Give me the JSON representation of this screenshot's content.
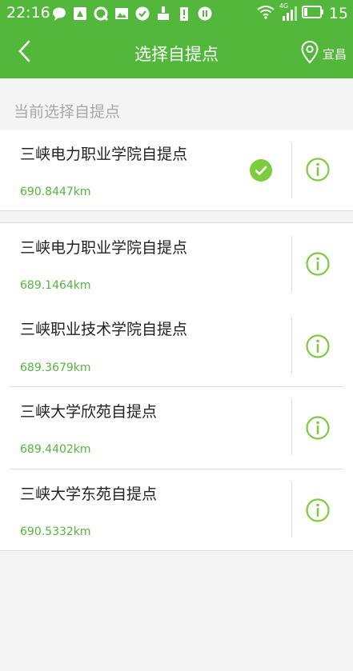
{
  "status_bar": {
    "time": "22:16",
    "battery_percent": "15",
    "network": "4G"
  },
  "header": {
    "title": "选择自提点",
    "location": "宜昌"
  },
  "section": {
    "current_label": "当前选择自提点"
  },
  "selected_point": {
    "name": "三峡电力职业学院自提点",
    "distance": "690.8447km"
  },
  "points": [
    {
      "name": "三峡电力职业学院自提点",
      "distance": "689.1464km"
    },
    {
      "name": "三峡职业技术学院自提点",
      "distance": "689.3679km"
    },
    {
      "name": "三峡大学欣苑自提点",
      "distance": "689.4402km"
    },
    {
      "name": "三峡大学东苑自提点",
      "distance": "690.5332km"
    }
  ],
  "colors": {
    "brand_green": "#52b73a",
    "info_green": "#7ccc3f"
  }
}
